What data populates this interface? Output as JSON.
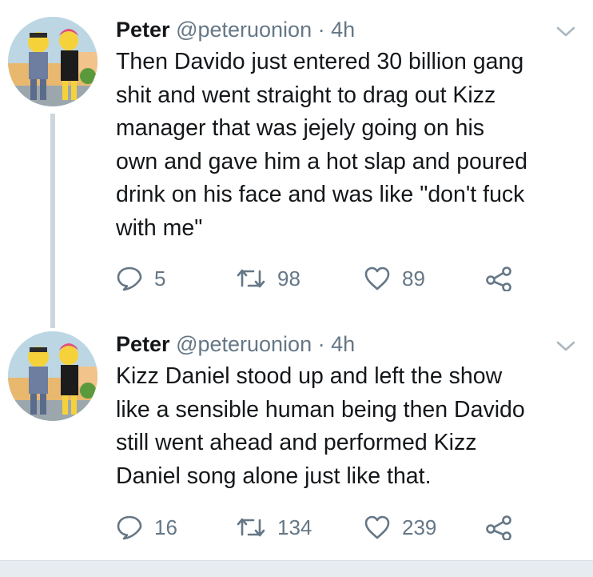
{
  "tweets": [
    {
      "author": {
        "name": "Peter",
        "handle": "@peteruonion",
        "separator": "·",
        "time": "4h",
        "avatar_icon": "simpsons-style-avatar"
      },
      "text": "Then Davido just entered 30 billion gang\nshit and went straight to drag out Kizz\nmanager that was jejely going on his\nown and gave him a hot slap and poured\ndrink on his face and was like \"don't fuck\nwith me\"",
      "replies": "5",
      "retweets": "98",
      "likes": "89"
    },
    {
      "author": {
        "name": "Peter",
        "handle": "@peteruonion",
        "separator": "·",
        "time": "4h",
        "avatar_icon": "simpsons-style-avatar"
      },
      "text": "Kizz Daniel stood up and left the show\nlike a sensible human being then Davido\nstill went ahead and performed Kizz\nDaniel song alone just like that.",
      "replies": "16",
      "retweets": "134",
      "likes": "239"
    }
  ],
  "icons": {
    "reply": "reply-icon",
    "retweet": "retweet-icon",
    "like": "heart-icon",
    "share": "share-icon",
    "menu": "chevron-down-icon"
  },
  "colors": {
    "text": "#14171a",
    "muted": "#657786",
    "thread_line": "#ccd6dd",
    "divider": "#e6ecf0"
  }
}
